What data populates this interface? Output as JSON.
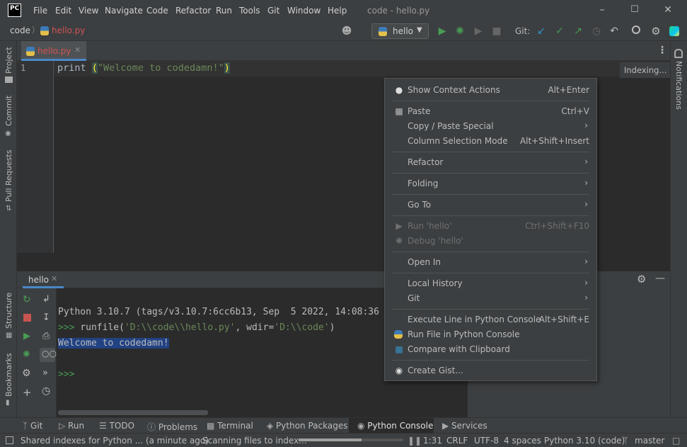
{
  "menu": [
    "File",
    "Edit",
    "View",
    "Navigate",
    "Code",
    "Refactor",
    "Run",
    "Tools",
    "Git",
    "Window",
    "Help"
  ],
  "window_title": "code - hello.py",
  "logo_text": "PC",
  "breadcrumb": {
    "project": "code",
    "file": "hello.py"
  },
  "run_config": "hello",
  "git_label": "Git:",
  "editor_tab": "hello.py",
  "editor": {
    "line_number": "1",
    "code_prefix": "print ",
    "open_paren": "(",
    "string": "\"Welcome to codedamn!\"",
    "close_paren": ")",
    "indexing": "Indexing..."
  },
  "left_stripe": {
    "project": "Project",
    "commit": "Commit",
    "pull_requests": "Pull Requests",
    "structure": "Structure",
    "bookmarks": "Bookmarks"
  },
  "right_stripe": {
    "notifications": "Notifications"
  },
  "tool_window_tab": "hello",
  "console": {
    "line1": "Python 3.10.7 (tags/v3.10.7:6cc6b13, Sep  5 2022, 14:08:36",
    "prompt1": ">>> ",
    "cmd_runfile": "runfile(",
    "cmd_arg1": "'D:\\\\code\\\\hello.py'",
    "cmd_mid": ", wdir=",
    "cmd_arg2": "'D:\\\\code'",
    "cmd_end": ")",
    "output": "Welcome to codedamn!",
    "prompt2": ">>>"
  },
  "context_menu": [
    {
      "label": "Show Context Actions",
      "shortcut": "Alt+Enter",
      "icon": "bulb-icon"
    },
    {
      "label": "Paste",
      "shortcut": "Ctrl+V",
      "icon": "clipboard-icon"
    },
    {
      "label": "Copy / Paste Special",
      "submenu": true
    },
    {
      "label": "Column Selection Mode",
      "shortcut": "Alt+Shift+Insert"
    },
    {
      "label": "Refactor",
      "submenu": true
    },
    {
      "label": "Folding",
      "submenu": true
    },
    {
      "label": "Go To",
      "submenu": true
    },
    {
      "label": "Run 'hello'",
      "shortcut": "Ctrl+Shift+F10",
      "disabled": true,
      "icon": "run-icon"
    },
    {
      "label": "Debug 'hello'",
      "disabled": true,
      "icon": "debug-icon"
    },
    {
      "label": "Open In",
      "submenu": true
    },
    {
      "label": "Local History",
      "submenu": true
    },
    {
      "label": "Git",
      "submenu": true
    },
    {
      "label": "Execute Line in Python Console",
      "shortcut": "Alt+Shift+E"
    },
    {
      "label": "Run File in Python Console",
      "icon": "python-icon"
    },
    {
      "label": "Compare with Clipboard",
      "icon": "compare-icon"
    },
    {
      "label": "Create Gist...",
      "icon": "github-icon"
    }
  ],
  "bottom_tools": [
    "Git",
    "Run",
    "TODO",
    "Problems",
    "Terminal",
    "Python Packages",
    "Python Console",
    "Services"
  ],
  "active_bottom_tool": "Python Console",
  "status": {
    "message": "Shared indexes for Python ... (a minute ago)",
    "progress_text": "Scanning files to index...",
    "progress": 0.6,
    "position": "1:31",
    "line_sep": "CRLF",
    "encoding": "UTF-8",
    "indent": "4 spaces",
    "interpreter": "Python 3.10 (code)",
    "branch": "master"
  },
  "colors": {
    "accent": "#4a88c7",
    "run_green": "#499c54",
    "string_green": "#6a8759",
    "selection": "#214283",
    "error_red": "#c75450"
  }
}
